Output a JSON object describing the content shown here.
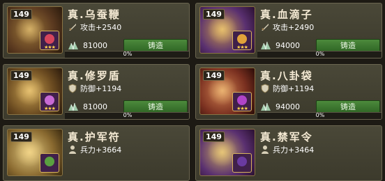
{
  "cards": [
    {
      "level": "149",
      "name": "真.乌蚕鞭",
      "stat_icon": "sword-icon",
      "stat": "攻击+2540",
      "cost": "81000",
      "button": "铸造",
      "progress": "0%",
      "progress_value": 0,
      "gem_color": "#d6455c",
      "art": "#7a5a3a"
    },
    {
      "level": "149",
      "name": "真.血滴子",
      "stat_icon": "sword-icon",
      "stat": "攻击+2490",
      "cost": "94000",
      "button": "铸造",
      "progress": "0%",
      "progress_value": 0,
      "gem_color": "#e2a23a",
      "art": "#8a5a9a"
    },
    {
      "level": "149",
      "name": "真.修罗盾",
      "stat_icon": "shield-icon",
      "stat": "防御+1194",
      "cost": "81000",
      "button": "铸造",
      "progress": "0%",
      "progress_value": 0,
      "gem_color": "#c86ad4",
      "art": "#8a6a30"
    },
    {
      "level": "149",
      "name": "真.八卦袋",
      "stat_icon": "shield-icon",
      "stat": "防御+1194",
      "cost": "94000",
      "button": "铸造",
      "progress": "0%",
      "progress_value": 0,
      "gem_color": "#b044c8",
      "art": "#9a3a2a"
    },
    {
      "level": "149",
      "name": "真.护军符",
      "stat_icon": "troops-icon",
      "stat": "兵力+3664",
      "cost": "",
      "button": "",
      "progress": "",
      "progress_value": 0,
      "gem_color": "#5aa040",
      "art": "#b8a060"
    },
    {
      "level": "149",
      "name": "真.禁军令",
      "stat_icon": "troops-icon",
      "stat": "兵力+3464",
      "cost": "",
      "button": "",
      "progress": "",
      "progress_value": 0,
      "gem_color": "#6a3aa0",
      "art": "#8a7040"
    }
  ]
}
